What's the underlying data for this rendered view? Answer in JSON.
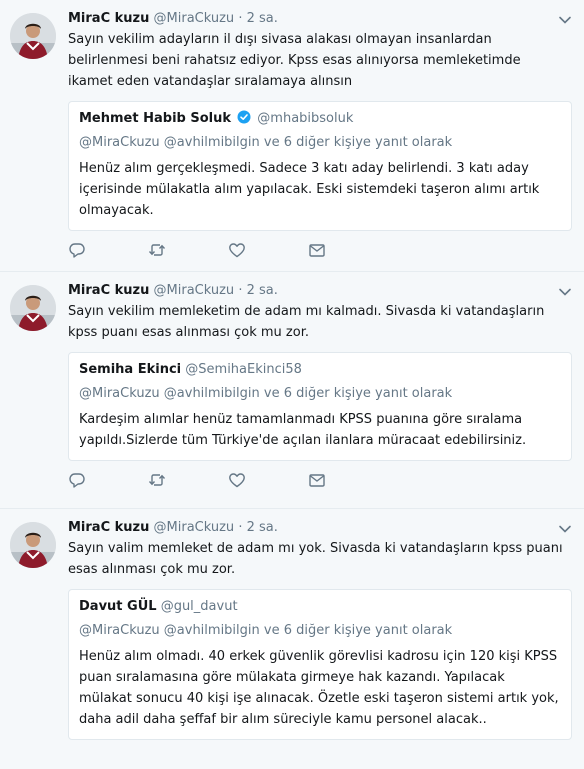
{
  "tweets": [
    {
      "name": "MiraC kuzu",
      "handle": "@MiraCkuzu",
      "dot": "·",
      "time": "2 sa.",
      "text": "Sayın vekilim adayların il dışı sivasa alakası olmayan insanlardan belirlenmesi beni rahatsız ediyor. Kpss esas alınıyorsa memleketimde ikamet eden vatandaşlar sıralamaya alınsın",
      "quote": {
        "name": "Mehmet Habib Soluk",
        "handle": "@mhabibsoluk",
        "reply_context": "@MiraCkuzu @avhilmibilgin ve 6 diğer kişiye yanıt olarak",
        "text": "Henüz alım gerçekleşmedi. Sadece 3 katı aday belirlendi. 3 katı aday içerisinde mülakatla alım yapılacak. Eski sistemdeki taşeron alımı artık olmayacak."
      }
    },
    {
      "name": "MiraC kuzu",
      "handle": "@MiraCkuzu",
      "dot": "·",
      "time": "2 sa.",
      "text": "Sayın vekilim memleketim de adam mı kalmadı. Sivasda ki vatandaşların kpss puanı esas alınması çok mu zor.",
      "quote": {
        "name": "Semiha Ekinci",
        "handle": "@SemihaEkinci58",
        "reply_context": "@MiraCkuzu @avhilmibilgin ve 6 diğer kişiye yanıt olarak",
        "text": "Kardeşim alımlar henüz tamamlanmadı KPSS puanına göre sıralama yapıldı.Sizlerde tüm Türkiye'de açılan ilanlara müracaat edebilirsiniz."
      }
    },
    {
      "name": "MiraC kuzu",
      "handle": "@MiraCkuzu",
      "dot": "·",
      "time": "2 sa.",
      "text": "Sayın valim memleket de adam mı yok. Sivasda ki vatandaşların kpss puanı esas alınması çok mu zor.",
      "quote": {
        "name": "Davut GÜL",
        "handle": "@gul_davut",
        "reply_context": "@MiraCkuzu @avhilmibilgin ve 6 diğer kişiye yanıt olarak",
        "text": "Henüz alım olmadı. 40 erkek güvenlik görevlisi kadrosu için 120 kişi KPSS puan sıralamasına göre mülakata girmeye hak kazandı. Yapılacak mülakat sonucu 40 kişi işe alınacak. Özetle eski taşeron sistemi artık yok, daha adil daha şeffaf bir alım süreciyle kamu personel alacak.."
      }
    }
  ],
  "icons": {
    "reply": "reply-icon",
    "retweet": "retweet-icon",
    "like": "heart-icon",
    "dm": "envelope-icon",
    "caret": "chevron-down-icon",
    "verified": "verified-badge-icon"
  },
  "colors": {
    "background": "#f5f8fa",
    "text": "#14171a",
    "secondary": "#657786",
    "verified": "#1da1f2",
    "border": "#e6ecf0"
  }
}
